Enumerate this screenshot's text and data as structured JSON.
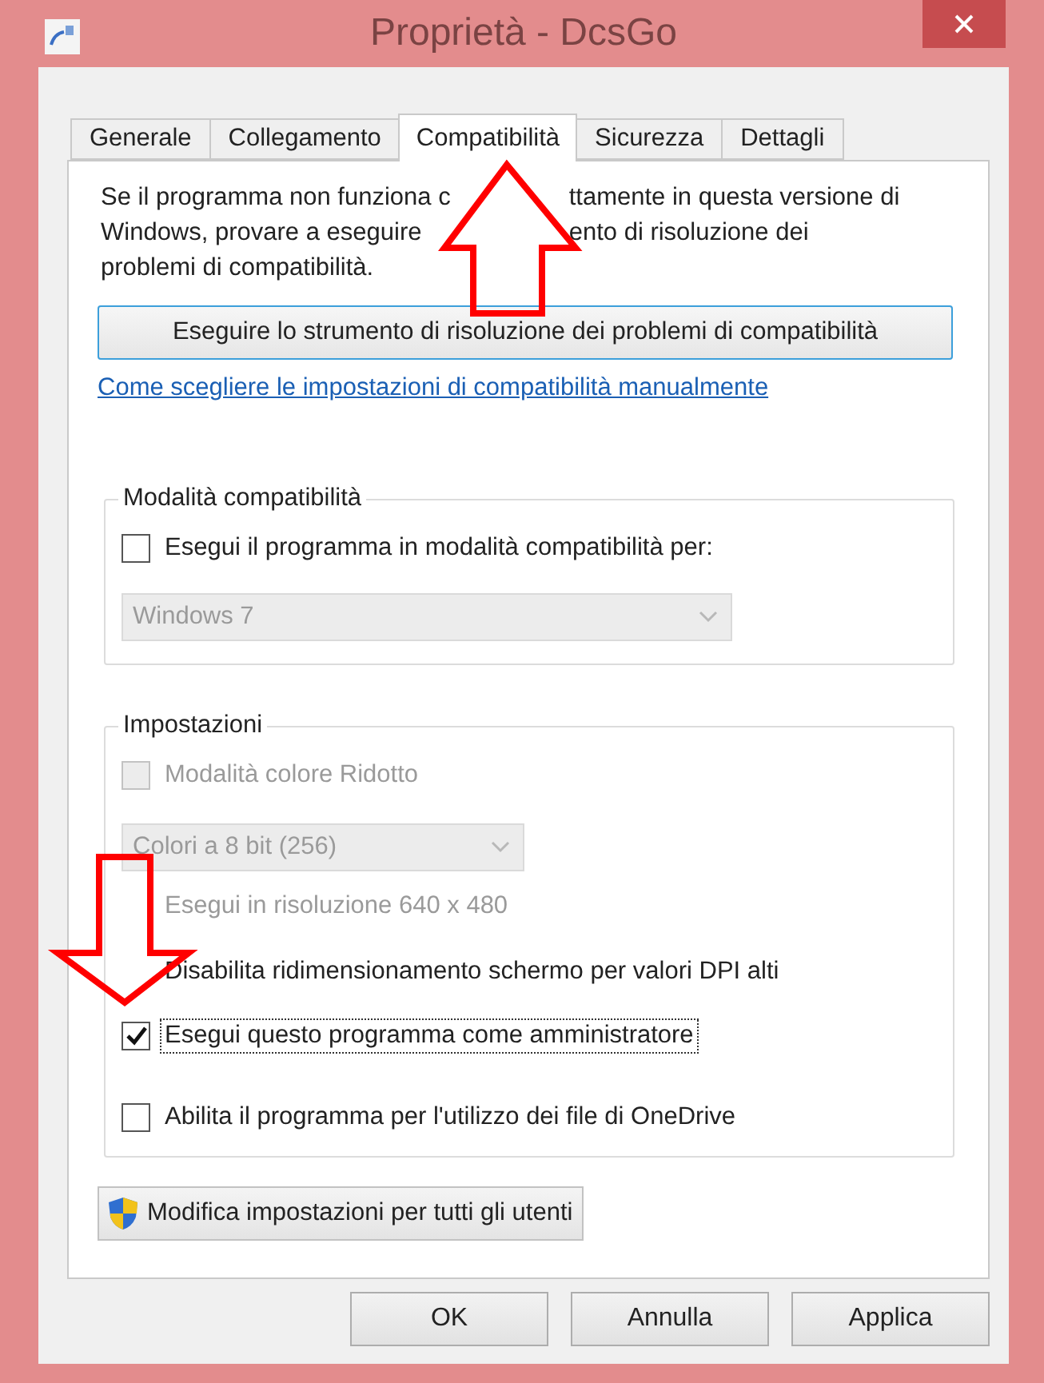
{
  "window": {
    "title": "Proprietà - DcsGo"
  },
  "tabs": [
    {
      "label": "Generale",
      "selected": false
    },
    {
      "label": "Collegamento",
      "selected": false
    },
    {
      "label": "Compatibilità",
      "selected": true
    },
    {
      "label": "Sicurezza",
      "selected": false
    },
    {
      "label": "Dettagli",
      "selected": false
    }
  ],
  "description_lines": [
    [
      "Se il programma non funziona c",
      "ttamente in questa versione di"
    ],
    [
      "Windows, provare a eseguire",
      "ento di risoluzione dei"
    ],
    [
      "problemi di compatibilità."
    ]
  ],
  "troubleshoot_button": "Eseguire lo strumento di risoluzione dei problemi di compatibilità",
  "help_link": "Come scegliere le impostazioni di compatibilità manualmente",
  "compat_mode": {
    "title": "Modalità compatibilità",
    "checkbox": {
      "label": "Esegui il programma in modalità compatibilità per:",
      "checked": false
    },
    "dropdown": {
      "value": "Windows 7",
      "disabled": true
    }
  },
  "settings": {
    "title": "Impostazioni",
    "items": [
      {
        "kind": "checkbox",
        "label": "Modalità colore Ridotto",
        "checked": false,
        "disabled": true,
        "focused": false
      },
      {
        "kind": "dropdown",
        "value": "Colori a 8 bit (256)",
        "disabled": true
      },
      {
        "kind": "checkbox",
        "label": "Esegui in risoluzione 640 x 480",
        "disabled": true,
        "focused": false
      },
      {
        "kind": "checkbox",
        "label": "Disabilita ridimensionamento schermo per valori DPI alti",
        "disabled": false,
        "focused": false
      },
      {
        "kind": "checkbox",
        "label": "Esegui questo programma come amministratore",
        "checked": true,
        "disabled": false,
        "focused": true
      },
      {
        "kind": "checkbox",
        "label": "Abilita il programma per l'utilizzo dei file di OneDrive",
        "checked": false,
        "disabled": false,
        "focused": false
      }
    ]
  },
  "all_users_button": "Modifica impostazioni per tutti gli utenti",
  "buttons": [
    {
      "label": "OK"
    },
    {
      "label": "Annulla"
    },
    {
      "label": "Applica"
    }
  ]
}
